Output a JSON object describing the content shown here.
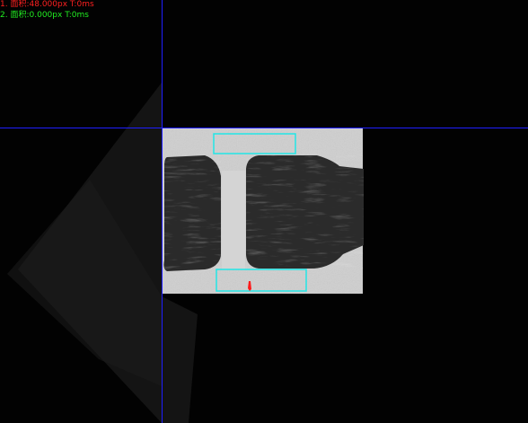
{
  "measurements": [
    {
      "index": "1.",
      "label": "面积:48.000px",
      "time": "T:0ms",
      "color": "#ff2020"
    },
    {
      "index": "2.",
      "label": "面积:0.000px",
      "time": "T:0ms",
      "color": "#22ee22"
    }
  ],
  "colors": {
    "crosshair": "#1e1eff",
    "roi_box": "#22e6e6",
    "defect_marker": "#ff1a1a",
    "background": "#020202",
    "frame_metal": "#c9c9c9",
    "chip_body": "#2c2c2c"
  },
  "icons": {
    "defect": "defect-marker-icon"
  }
}
